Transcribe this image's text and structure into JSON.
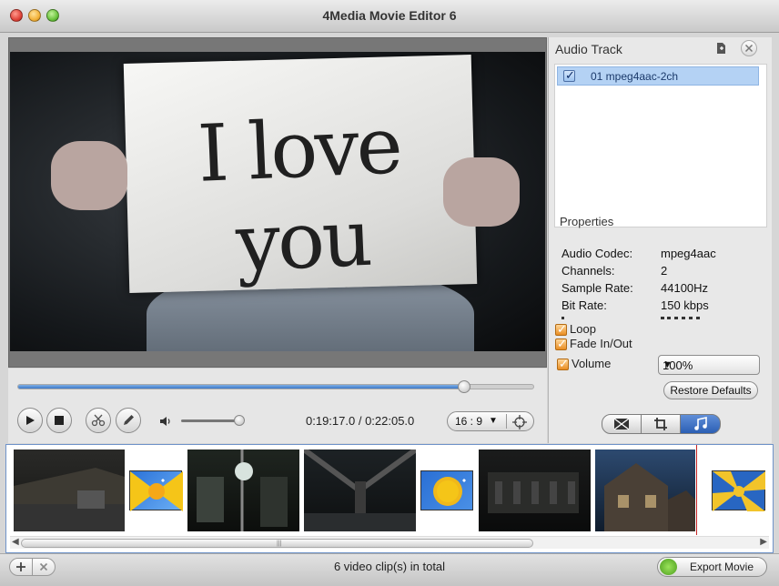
{
  "window": {
    "title": "4Media Movie Editor 6"
  },
  "preview": {
    "sign_text": "I love you",
    "progress": 0.865
  },
  "playback": {
    "current_time": "0:19:17.0",
    "separator": " / ",
    "total_time": "0:22:05.0",
    "volume": 1.0,
    "aspect_ratio": "16 : 9"
  },
  "audio_panel": {
    "title": "Audio Track",
    "tracks": [
      {
        "label": "01 mpeg4aac-2ch",
        "checked": true,
        "selected": true
      }
    ],
    "properties_title": "Properties",
    "properties": [
      {
        "key": "Audio Codec:",
        "value": "mpeg4aac"
      },
      {
        "key": "Channels:",
        "value": "2"
      },
      {
        "key": "Sample Rate:",
        "value": "44100Hz"
      },
      {
        "key": "Bit Rate:",
        "value": "150 kbps"
      }
    ],
    "loop_label": "Loop",
    "fade_label": "Fade In/Out",
    "volume_label": "Volume",
    "volume_value": "100%",
    "restore_label": "Restore Defaults",
    "tabs": [
      "effect",
      "crop",
      "audio"
    ],
    "active_tab": "audio"
  },
  "timeline": {
    "clip_count": 6,
    "scroll_position": 0.0
  },
  "status": {
    "text": "6 video clip(s) in total"
  },
  "export": {
    "label": "Export Movie"
  },
  "colors": {
    "accent": "#3c78c9",
    "selection": "#b4d2f4",
    "playhead": "#c62424",
    "check_orange": "#e98d22"
  }
}
